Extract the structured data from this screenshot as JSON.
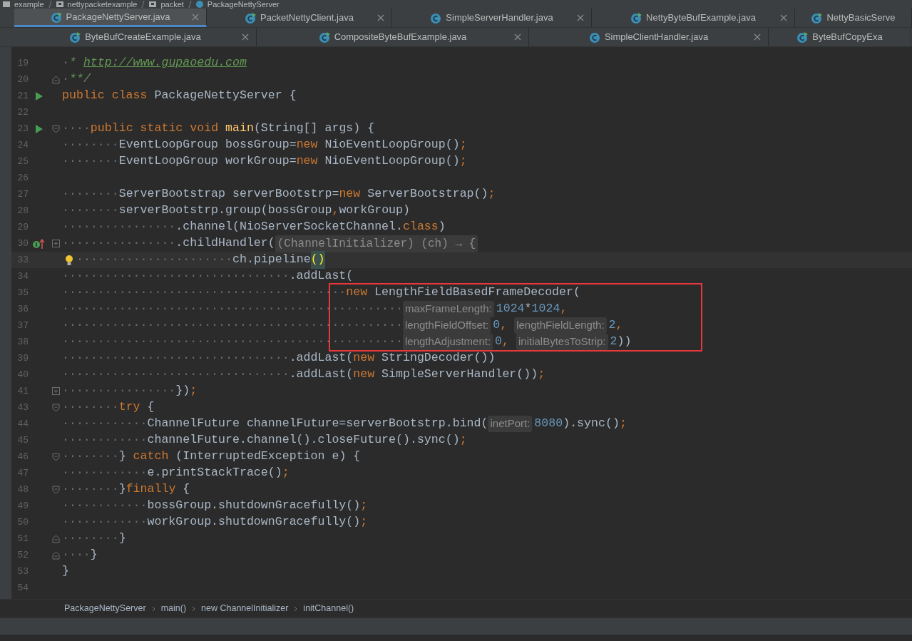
{
  "path": [
    {
      "label": "example",
      "kind": "module"
    },
    {
      "label": "nettypacketexample",
      "kind": "package"
    },
    {
      "label": "packet",
      "kind": "package"
    },
    {
      "label": "PackageNettyServer",
      "kind": "class"
    }
  ],
  "tab_rows": [
    [
      {
        "label": "PackageNettyServer.java",
        "selected": true,
        "runnable": true,
        "closable": true
      },
      {
        "label": "PacketNettyClient.java",
        "selected": false,
        "runnable": true,
        "closable": true
      },
      {
        "label": "SimpleServerHandler.java",
        "selected": false,
        "runnable": false,
        "closable": true
      },
      {
        "label": "NettyByteBufExample.java",
        "selected": false,
        "runnable": true,
        "closable": true
      },
      {
        "label": "NettyBasicServe",
        "selected": false,
        "runnable": true,
        "closable": false
      }
    ],
    [
      {
        "label": "ByteBufCreateExample.java",
        "selected": false,
        "runnable": true,
        "closable": true
      },
      {
        "label": "CompositeByteBufExample.java",
        "selected": false,
        "runnable": true,
        "closable": true
      },
      {
        "label": "SimpleClientHandler.java",
        "selected": false,
        "runnable": false,
        "closable": true
      },
      {
        "label": "ByteBufCopyExa",
        "selected": false,
        "runnable": true,
        "closable": false
      }
    ]
  ],
  "code_lines": [
    {
      "number": "19",
      "tokens": [
        {
          "kind": "whitespace",
          "text": "·"
        },
        {
          "kind": "comment",
          "text": "* "
        },
        {
          "kind": "link",
          "text": "http://www.gupaoedu.com"
        }
      ]
    },
    {
      "number": "20",
      "fold_icon": {
        "kind": "end"
      },
      "tokens": [
        {
          "kind": "whitespace",
          "text": "·"
        },
        {
          "kind": "comment",
          "text": "**/"
        }
      ]
    },
    {
      "number": "21",
      "gutter_icon": {
        "kind": "run"
      },
      "tokens": [
        {
          "kind": "keyword",
          "text": "public class "
        },
        {
          "kind": "plain",
          "text": "PackageNettyServer {"
        }
      ]
    },
    {
      "number": "22"
    },
    {
      "number": "23",
      "gutter_icon": {
        "kind": "run"
      },
      "fold_icon": {
        "kind": "start"
      },
      "tokens": [
        {
          "kind": "whitespace",
          "text": "····"
        },
        {
          "kind": "keyword",
          "text": "public static void "
        },
        {
          "kind": "method",
          "text": "main"
        },
        {
          "kind": "plain",
          "text": "(String[] args) {"
        }
      ]
    },
    {
      "number": "24",
      "tokens": [
        {
          "kind": "whitespace",
          "text": "········"
        },
        {
          "kind": "plain",
          "text": "EventLoopGroup bossGroup="
        },
        {
          "kind": "keyword",
          "text": "new"
        },
        {
          "kind": "plain",
          "text": " NioEventLoopGroup()"
        },
        {
          "kind": "keyword",
          "text": ";"
        }
      ]
    },
    {
      "number": "25",
      "tokens": [
        {
          "kind": "whitespace",
          "text": "········"
        },
        {
          "kind": "plain",
          "text": "EventLoopGroup workGroup="
        },
        {
          "kind": "keyword",
          "text": "new"
        },
        {
          "kind": "plain",
          "text": " NioEventLoopGroup()"
        },
        {
          "kind": "keyword",
          "text": ";"
        }
      ]
    },
    {
      "number": "26"
    },
    {
      "number": "27",
      "tokens": [
        {
          "kind": "whitespace",
          "text": "········"
        },
        {
          "kind": "plain",
          "text": "ServerBootstrap serverBootstrp="
        },
        {
          "kind": "keyword",
          "text": "new"
        },
        {
          "kind": "plain",
          "text": " ServerBootstrap()"
        },
        {
          "kind": "keyword",
          "text": ";"
        }
      ]
    },
    {
      "number": "28",
      "tokens": [
        {
          "kind": "whitespace",
          "text": "········"
        },
        {
          "kind": "plain",
          "text": "serverBootstrp.group(bossGroup"
        },
        {
          "kind": "keyword",
          "text": ","
        },
        {
          "kind": "plain",
          "text": "workGroup)"
        }
      ]
    },
    {
      "number": "29",
      "tokens": [
        {
          "kind": "whitespace",
          "text": "················"
        },
        {
          "kind": "plain",
          "text": ".channel(NioServerSocketChannel."
        },
        {
          "kind": "keyword",
          "text": "class"
        },
        {
          "kind": "plain",
          "text": ")"
        }
      ]
    },
    {
      "number": "30",
      "gutter_icon": {
        "kind": "override"
      },
      "fold_icon": {
        "kind": "collapsed"
      },
      "tokens": [
        {
          "kind": "whitespace",
          "text": "················"
        },
        {
          "kind": "plain",
          "text": ".childHandler("
        },
        {
          "kind": "folded",
          "text": "(ChannelInitializer) (ch) → {"
        }
      ]
    },
    {
      "number": "33",
      "caret": true,
      "bulb": true,
      "tokens": [
        {
          "kind": "whitespace",
          "text": "······················"
        },
        {
          "kind": "plain",
          "text": "ch.pipeline"
        },
        {
          "kind": "paren",
          "text": "()"
        }
      ]
    },
    {
      "number": "34",
      "tokens": [
        {
          "kind": "whitespace",
          "text": "································"
        },
        {
          "kind": "plain",
          "text": ".addLast("
        }
      ]
    },
    {
      "number": "35",
      "boxed": true,
      "tokens": [
        {
          "kind": "whitespace",
          "text": "········································"
        },
        {
          "kind": "keyword",
          "text": "new"
        },
        {
          "kind": "plain",
          "text": " LengthFieldBasedFrameDecoder("
        }
      ]
    },
    {
      "number": "36",
      "boxed": true,
      "tokens": [
        {
          "kind": "whitespace",
          "text": "················································"
        },
        {
          "kind": "hint",
          "text": "maxFrameLength:"
        },
        {
          "kind": "number",
          "text": "1024"
        },
        {
          "kind": "plain",
          "text": "*"
        },
        {
          "kind": "number",
          "text": "1024"
        },
        {
          "kind": "keyword",
          "text": ","
        }
      ]
    },
    {
      "number": "37",
      "boxed": true,
      "tokens": [
        {
          "kind": "whitespace",
          "text": "················································"
        },
        {
          "kind": "hint",
          "text": "lengthFieldOffset:"
        },
        {
          "kind": "number",
          "text": "0"
        },
        {
          "kind": "keyword",
          "text": ", "
        },
        {
          "kind": "hint",
          "text": "lengthFieldLength:"
        },
        {
          "kind": "number",
          "text": "2"
        },
        {
          "kind": "keyword",
          "text": ","
        }
      ]
    },
    {
      "number": "38",
      "boxed": true,
      "tokens": [
        {
          "kind": "whitespace",
          "text": "················································"
        },
        {
          "kind": "hint",
          "text": "lengthAdjustment:"
        },
        {
          "kind": "number",
          "text": "0"
        },
        {
          "kind": "keyword",
          "text": ", "
        },
        {
          "kind": "hint",
          "text": "initialBytesToStrip:"
        },
        {
          "kind": "number",
          "text": "2"
        },
        {
          "kind": "plain",
          "text": "))"
        }
      ]
    },
    {
      "number": "39",
      "tokens": [
        {
          "kind": "whitespace",
          "text": "································"
        },
        {
          "kind": "plain",
          "text": ".addLast("
        },
        {
          "kind": "keyword",
          "text": "new"
        },
        {
          "kind": "plain",
          "text": " StringDecoder())"
        }
      ]
    },
    {
      "number": "40",
      "tokens": [
        {
          "kind": "whitespace",
          "text": "································"
        },
        {
          "kind": "plain",
          "text": ".addLast("
        },
        {
          "kind": "keyword",
          "text": "new"
        },
        {
          "kind": "plain",
          "text": " SimpleServerHandler())"
        },
        {
          "kind": "keyword",
          "text": ";"
        }
      ]
    },
    {
      "number": "41",
      "fold_icon": {
        "kind": "collapsed"
      },
      "tokens": [
        {
          "kind": "whitespace",
          "text": "················"
        },
        {
          "kind": "plain",
          "text": "})"
        },
        {
          "kind": "keyword",
          "text": ";"
        }
      ]
    },
    {
      "number": "43",
      "fold_icon": {
        "kind": "start"
      },
      "tokens": [
        {
          "kind": "whitespace",
          "text": "········"
        },
        {
          "kind": "keyword",
          "text": "try"
        },
        {
          "kind": "plain",
          "text": " {"
        }
      ]
    },
    {
      "number": "44",
      "tokens": [
        {
          "kind": "whitespace",
          "text": "············"
        },
        {
          "kind": "plain",
          "text": "ChannelFuture channelFuture=serverBootstrp.bind("
        },
        {
          "kind": "hint",
          "text": "inetPort:"
        },
        {
          "kind": "number",
          "text": "8080"
        },
        {
          "kind": "plain",
          "text": ").sync()"
        },
        {
          "kind": "keyword",
          "text": ";"
        }
      ]
    },
    {
      "number": "45",
      "tokens": [
        {
          "kind": "whitespace",
          "text": "············"
        },
        {
          "kind": "plain",
          "text": "channelFuture.channel().closeFuture().sync()"
        },
        {
          "kind": "keyword",
          "text": ";"
        }
      ]
    },
    {
      "number": "46",
      "fold_icon": {
        "kind": "start"
      },
      "tokens": [
        {
          "kind": "whitespace",
          "text": "········"
        },
        {
          "kind": "plain",
          "text": "} "
        },
        {
          "kind": "keyword",
          "text": "catch"
        },
        {
          "kind": "plain",
          "text": " (InterruptedException e) {"
        }
      ]
    },
    {
      "number": "47",
      "tokens": [
        {
          "kind": "whitespace",
          "text": "············"
        },
        {
          "kind": "plain",
          "text": "e.printStackTrace()"
        },
        {
          "kind": "keyword",
          "text": ";"
        }
      ]
    },
    {
      "number": "48",
      "fold_icon": {
        "kind": "start"
      },
      "tokens": [
        {
          "kind": "whitespace",
          "text": "········"
        },
        {
          "kind": "plain",
          "text": "}"
        },
        {
          "kind": "keyword",
          "text": "finally"
        },
        {
          "kind": "plain",
          "text": " {"
        }
      ]
    },
    {
      "number": "49",
      "tokens": [
        {
          "kind": "whitespace",
          "text": "············"
        },
        {
          "kind": "plain",
          "text": "bossGroup.shutdownGracefully()"
        },
        {
          "kind": "keyword",
          "text": ";"
        }
      ]
    },
    {
      "number": "50",
      "tokens": [
        {
          "kind": "whitespace",
          "text": "············"
        },
        {
          "kind": "plain",
          "text": "workGroup.shutdownGracefully()"
        },
        {
          "kind": "keyword",
          "text": ";"
        }
      ]
    },
    {
      "number": "51",
      "fold_icon": {
        "kind": "end"
      },
      "tokens": [
        {
          "kind": "whitespace",
          "text": "········"
        },
        {
          "kind": "plain",
          "text": "}"
        }
      ]
    },
    {
      "number": "52",
      "fold_icon": {
        "kind": "end"
      },
      "tokens": [
        {
          "kind": "whitespace",
          "text": "····"
        },
        {
          "kind": "plain",
          "text": "}"
        }
      ]
    },
    {
      "number": "53",
      "tokens": [
        {
          "kind": "plain",
          "text": "}"
        }
      ]
    },
    {
      "number": "54"
    }
  ],
  "breadcrumbs": [
    "PackageNettyServer",
    "main()",
    "new ChannelInitializer",
    "initChannel()"
  ]
}
